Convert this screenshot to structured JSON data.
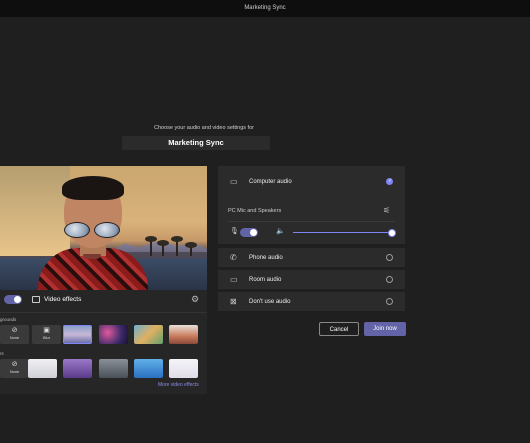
{
  "window": {
    "title": "Marketing Sync"
  },
  "prompt": "Choose your audio and video settings for",
  "meeting_name": "Marketing Sync",
  "preview": {
    "video_effects_label": "Video effects",
    "backgrounds_label": "grounds",
    "backgrounds": [
      {
        "label": "None",
        "icon": "⊘"
      },
      {
        "label": "Blur",
        "icon": "▣"
      }
    ],
    "filters_label": "rs",
    "filters": [
      {
        "label": "None",
        "icon": "⊘"
      }
    ],
    "more_effects_link": "More video effects",
    "camera_on": true
  },
  "audio": {
    "options": [
      {
        "label": "Computer audio",
        "icon": "computer-icon",
        "selected": true
      },
      {
        "label": "Phone audio",
        "icon": "phone-icon",
        "selected": false
      },
      {
        "label": "Room audio",
        "icon": "room-icon",
        "selected": false
      },
      {
        "label": "Don't use audio",
        "icon": "no-audio-icon",
        "selected": false
      }
    ],
    "device_label": "PC Mic and Speakers",
    "mic_on": true,
    "speaker_volume": 1.0
  },
  "actions": {
    "cancel_label": "Cancel",
    "join_label": "Join now"
  },
  "colors": {
    "accent": "#6264a7",
    "accent_light": "#7f85f5",
    "background": "#1f1f1f"
  }
}
